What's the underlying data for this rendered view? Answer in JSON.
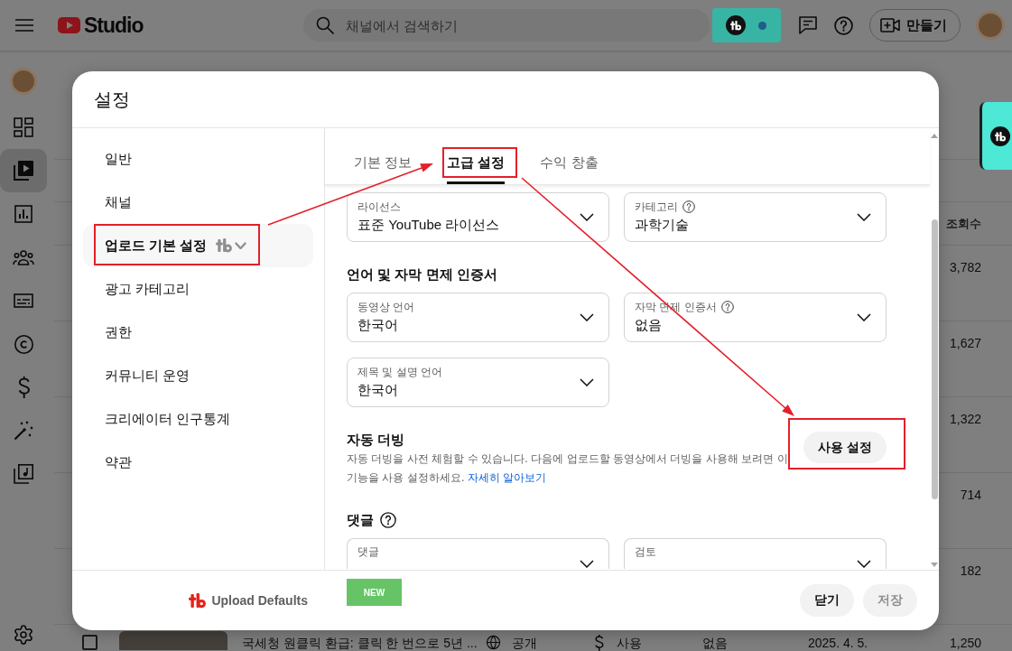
{
  "top_bar": {
    "logo_text": "Studio",
    "search": {
      "placeholder": "채널에서 검색하기"
    },
    "create_button": "만들기"
  },
  "nav_rail": {
    "items": [
      {
        "selected": false
      },
      {
        "selected": true
      },
      {
        "selected": false
      },
      {
        "selected": false
      },
      {
        "selected": false
      },
      {
        "selected": false
      },
      {
        "selected": false
      },
      {
        "selected": false
      },
      {
        "selected": false
      }
    ]
  },
  "content_table": {
    "views_heading": "조회수",
    "rows": [
      {
        "views": "3,782"
      },
      {
        "views": "1,627"
      },
      {
        "views": "1,322"
      },
      {
        "views": "714"
      },
      {
        "views": "182"
      },
      {
        "checked": false,
        "title": "국세청 원클릭 환급: 클릭 한 번으로 5년 ...",
        "visibility": "공개",
        "monetization": "사용",
        "column_5": "없음",
        "date": "2025. 4. 5.",
        "views": "1,250"
      }
    ]
  },
  "dialog": {
    "title": "설정",
    "sidebar": {
      "items": [
        {
          "label": "일반",
          "selected": false,
          "addon": false,
          "marked": false
        },
        {
          "label": "채널",
          "selected": false,
          "addon": false,
          "marked": false
        },
        {
          "label": "업로드 기본 설정",
          "selected": true,
          "addon": true,
          "marked": true
        },
        {
          "label": "광고 카테고리",
          "selected": false,
          "addon": false,
          "marked": false
        },
        {
          "label": "권한",
          "selected": false,
          "addon": false,
          "marked": false
        },
        {
          "label": "커뮤니티 운영",
          "selected": false,
          "addon": false,
          "marked": false
        },
        {
          "label": "크리에이터 인구통계",
          "selected": false,
          "addon": false,
          "marked": false
        },
        {
          "label": "약관",
          "selected": false,
          "addon": false,
          "marked": false
        }
      ]
    },
    "tabs": [
      {
        "label": "기본 정보",
        "selected": false,
        "marked": false
      },
      {
        "label": "고급 설정",
        "selected": true,
        "marked": true
      },
      {
        "label": "수익 창출",
        "selected": false,
        "marked": false
      }
    ],
    "sections": [
      {
        "kind": "fields",
        "fields": [
          {
            "label": "라이선스",
            "help": false,
            "value": "표준 YouTube 라이선스"
          },
          {
            "label": "카테고리",
            "help": true,
            "value": "과학기술"
          }
        ]
      },
      {
        "kind": "fields",
        "heading": "언어 및 자막 면제 인증서",
        "heading_help": false,
        "fields": [
          {
            "label": "동영상 언어",
            "help": false,
            "value": "한국어"
          },
          {
            "label": "자막 면제 인증서",
            "help": true,
            "value": "없음"
          },
          {
            "label": "제목 및 설명 언어",
            "help": false,
            "value": "한국어"
          }
        ]
      },
      {
        "kind": "feature",
        "heading": "자동 더빙",
        "description": "자동 더빙을 사전 체험할 수 있습니다. 다음에 업로드할 동영상에서 더빙을 사용해 보려면 이 기능을 사용 설정하세요.",
        "link": "자세히 알아보기",
        "button": {
          "label": "사용 설정",
          "marked": true
        }
      },
      {
        "kind": "fields",
        "heading": "댓글",
        "heading_help": true,
        "fields": [
          {
            "label": "댓글",
            "help": false
          },
          {
            "label": "검토",
            "help": false
          }
        ]
      }
    ],
    "footer": {
      "extension_label": "Upload Defaults",
      "badge": "NEW",
      "buttons": [
        {
          "label": "닫기",
          "disabled": false
        },
        {
          "label": "저장",
          "disabled": true
        }
      ]
    }
  }
}
